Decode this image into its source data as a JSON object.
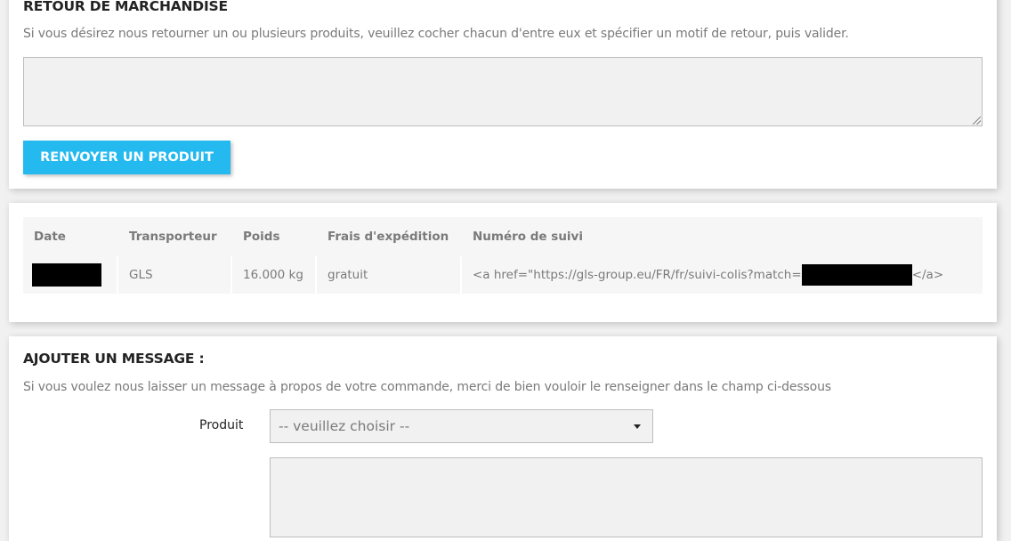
{
  "return_section": {
    "title": "RETOUR DE MARCHANDISE",
    "intro": "Si vous désirez nous retourner un ou plusieurs produits, veuillez cocher chacun d'entre eux et spécifier un motif de retour, puis valider.",
    "textarea_value": "",
    "button_label": "RENVOYER UN PRODUIT"
  },
  "shipping_table": {
    "headers": [
      "Date",
      "Transporteur",
      "Poids",
      "Frais d'expédition",
      "Numéro de suivi"
    ],
    "row": {
      "date": "",
      "carrier": "GLS",
      "weight": "16.000 kg",
      "shipping_cost": "gratuit",
      "tracking_prefix": "<a href=\"https://gls-group.eu/FR/fr/suivi-colis?match=",
      "tracking_suffix": "</a>"
    }
  },
  "message_section": {
    "title": "AJOUTER UN MESSAGE :",
    "intro": "Si vous voulez nous laisser un message à propos de votre commande, merci de bien vouloir le renseigner dans le champ ci-dessous",
    "product_label": "Produit",
    "product_select_value": "-- veuillez choisir --",
    "message_value": ""
  },
  "icons": {
    "select_caret": "chevron-down-icon",
    "textarea_resize": "resize-grip-icon"
  },
  "colors": {
    "accent": "#24b9ef",
    "heading_text": "#232323",
    "body_text": "#7a7a7a",
    "page_background": "#f1f1f1"
  }
}
